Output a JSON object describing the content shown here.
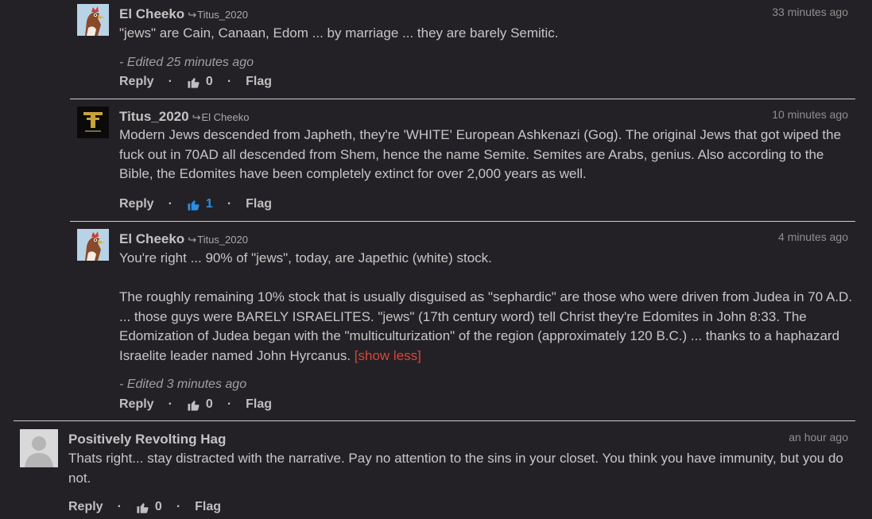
{
  "comments": [
    {
      "author": "El Cheeko",
      "reply_to": "Titus_2020",
      "time": "33 minutes ago",
      "text": "\"jews\" are Cain, Canaan, Edom ... by marriage ... they are barely Semitic.",
      "edited": "- Edited 25 minutes ago",
      "reply_label": "Reply",
      "likes": "0",
      "flag_label": "Flag"
    },
    {
      "author": "Titus_2020",
      "reply_to": "El Cheeko",
      "time": "10 minutes ago",
      "text": "Modern Jews descended from Japheth, they're 'WHITE' European Ashkenazi (Gog). The original Jews that got wiped the fuck out in 70AD all descended from Shem, hence the name Semite. Semites are Arabs, genius. Also according to the Bible, the Edomites have been completely extinct for over 2,000 years as well.",
      "reply_label": "Reply",
      "likes": "1",
      "flag_label": "Flag"
    },
    {
      "author": "El Cheeko",
      "reply_to": "Titus_2020",
      "time": "4 minutes ago",
      "text_p1": "You're right ... 90% of \"jews\", today, are Japethic (white) stock.",
      "text_p2": "The roughly remaining 10% stock that is usually disguised as \"sephardic\" are those who were driven from Judea in 70 A.D. ... those guys were BARELY ISRAELITES. \"jews\" (17th century word) tell Christ they're Edomites in John 8:33. The Edomization of Judea began with the \"multiculturization\" of the region (approximately 120 B.C.) ... thanks to a haphazard Israelite leader named John Hyrcanus.",
      "show_less": "[show less]",
      "edited": "- Edited 3 minutes ago",
      "reply_label": "Reply",
      "likes": "0",
      "flag_label": "Flag"
    },
    {
      "author": "Positively Revolting Hag",
      "time": "an hour ago",
      "text": "Thats right... stay distracted with the narrative. Pay no attention to the sins in your closet. You think you have immunity, but you do not.",
      "reply_label": "Reply",
      "likes": "0",
      "flag_label": "Flag"
    }
  ],
  "colors": {
    "background": "#232125",
    "like_active": "#2a8ee6",
    "show_less": "#d9463a"
  }
}
